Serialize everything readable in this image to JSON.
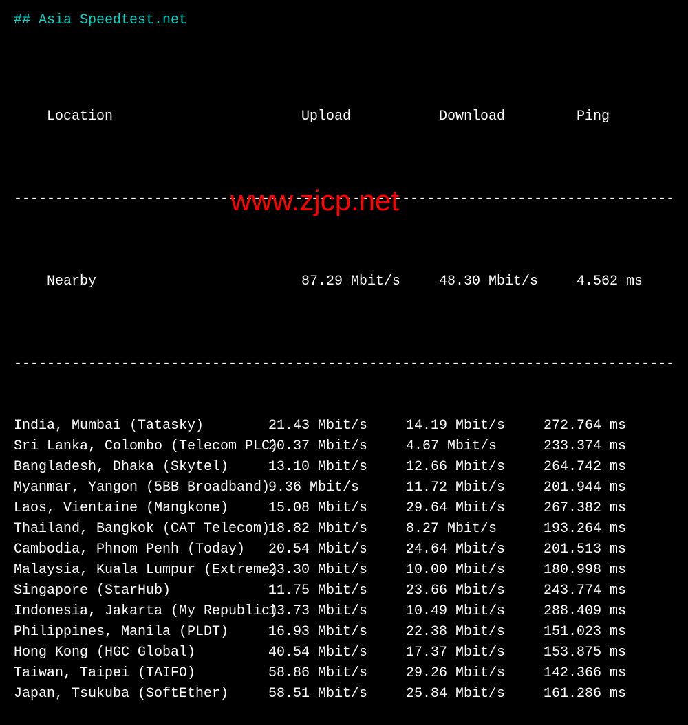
{
  "title": "## Asia Speedtest.net",
  "headers": {
    "location": "Location",
    "upload": "Upload",
    "download": "Download",
    "ping": "Ping"
  },
  "divider": "---------------------------------------------------------------------------------",
  "nearby": {
    "location": "Nearby",
    "upload": "87.29 Mbit/s",
    "download": "48.30 Mbit/s",
    "ping": "4.562 ms"
  },
  "rows": [
    {
      "location": "India, Mumbai (Tatasky)",
      "upload": "21.43 Mbit/s",
      "download": "14.19 Mbit/s",
      "ping": "272.764 ms"
    },
    {
      "location": "Sri Lanka, Colombo (Telecom PLC)",
      "upload": "20.37 Mbit/s",
      "download": "4.67 Mbit/s",
      "ping": "233.374 ms"
    },
    {
      "location": "Bangladesh, Dhaka (Skytel)",
      "upload": "13.10 Mbit/s",
      "download": "12.66 Mbit/s",
      "ping": "264.742 ms"
    },
    {
      "location": "Myanmar, Yangon (5BB Broadband)",
      "upload": "9.36 Mbit/s",
      "download": "11.72 Mbit/s",
      "ping": "201.944 ms"
    },
    {
      "location": "Laos, Vientaine (Mangkone)",
      "upload": "15.08 Mbit/s",
      "download": "29.64 Mbit/s",
      "ping": "267.382 ms"
    },
    {
      "location": "Thailand, Bangkok (CAT Telecom)",
      "upload": "18.82 Mbit/s",
      "download": "8.27 Mbit/s",
      "ping": "193.264 ms"
    },
    {
      "location": "Cambodia, Phnom Penh (Today)",
      "upload": "20.54 Mbit/s",
      "download": "24.64 Mbit/s",
      "ping": "201.513 ms"
    },
    {
      "location": "Malaysia, Kuala Lumpur (Extreme)",
      "upload": "23.30 Mbit/s",
      "download": "10.00 Mbit/s",
      "ping": "180.998 ms"
    },
    {
      "location": "Singapore (StarHub)",
      "upload": "11.75 Mbit/s",
      "download": "23.66 Mbit/s",
      "ping": "243.774 ms"
    },
    {
      "location": "Indonesia, Jakarta (My Republic)",
      "upload": "13.73 Mbit/s",
      "download": "10.49 Mbit/s",
      "ping": "288.409 ms"
    },
    {
      "location": "Philippines, Manila (PLDT)",
      "upload": "16.93 Mbit/s",
      "download": "22.38 Mbit/s",
      "ping": "151.023 ms"
    },
    {
      "location": "Hong Kong (HGC Global)",
      "upload": "40.54 Mbit/s",
      "download": "17.37 Mbit/s",
      "ping": "153.875 ms"
    },
    {
      "location": "Taiwan, Taipei (TAIFO)",
      "upload": "58.86 Mbit/s",
      "download": "29.26 Mbit/s",
      "ping": "142.366 ms"
    },
    {
      "location": "Japan, Tsukuba (SoftEther)",
      "upload": "58.51 Mbit/s",
      "download": "25.84 Mbit/s",
      "ping": "161.286 ms"
    }
  ],
  "watermark": "www.zjcp.net"
}
